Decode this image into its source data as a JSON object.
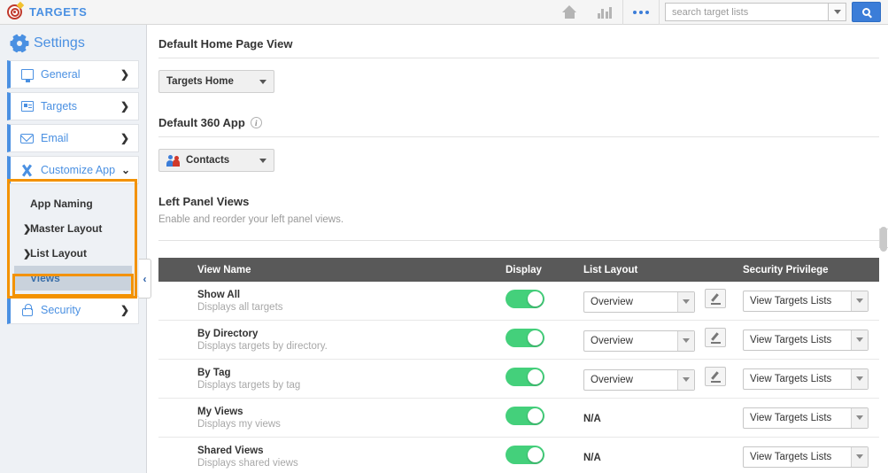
{
  "topbar": {
    "brand": "TARGETS",
    "brand_icon": "bullseye-target-icon",
    "icons": [
      {
        "name": "home-icon",
        "label": "Home"
      },
      {
        "name": "bar-chart-icon",
        "label": "Analytics"
      },
      {
        "name": "more-dots-icon",
        "label": "More"
      }
    ],
    "search": {
      "placeholder": "search target lists",
      "value": "",
      "dropdown_icon": "chevron-down-icon",
      "button_icon": "search-icon"
    }
  },
  "sidebar": {
    "title": "Settings",
    "title_icon": "gear-icon",
    "items": [
      {
        "label": "General",
        "icon": "monitor-icon",
        "chevron": "❯",
        "expanded": false
      },
      {
        "label": "Targets",
        "icon": "list-card-icon",
        "chevron": "❯",
        "expanded": false
      },
      {
        "label": "Email",
        "icon": "envelope-icon",
        "chevron": "❯",
        "expanded": false
      },
      {
        "label": "Customize App",
        "icon": "tools-icon",
        "chevron": "⌄",
        "expanded": true
      },
      {
        "label": "Security",
        "icon": "lock-icon",
        "chevron": "❯",
        "expanded": false
      }
    ],
    "sub_items": [
      {
        "label": "App Naming",
        "arrow": "",
        "selected": false
      },
      {
        "label": "Master Layout",
        "arrow": "❯",
        "selected": false
      },
      {
        "label": "List Layout",
        "arrow": "❯",
        "selected": false
      },
      {
        "label": "Views",
        "arrow": "",
        "selected": true
      }
    ],
    "collapse_handle": "‹",
    "highlight_color": "#f39200"
  },
  "main": {
    "home_page_view": {
      "title": "Default Home Page View",
      "dropdown_value": "Targets Home"
    },
    "default_360_app": {
      "title": "Default 360 App",
      "info_icon": "info-icon",
      "dropdown_value": "Contacts",
      "dropdown_icon": "people-icon"
    },
    "left_panel_views": {
      "title": "Left Panel Views",
      "description": "Enable and reorder your left panel views.",
      "columns": [
        "View Name",
        "Display",
        "List Layout",
        "Security Privilege"
      ],
      "rows": [
        {
          "name": "Show All",
          "description": "Displays all targets",
          "display_on": true,
          "list_layout": "Overview",
          "has_layout_select": true,
          "has_edit_button": true,
          "security_privilege": "View Targets Lists"
        },
        {
          "name": "By Directory",
          "description": "Displays targets by directory.",
          "display_on": true,
          "list_layout": "Overview",
          "has_layout_select": true,
          "has_edit_button": true,
          "security_privilege": "View Targets Lists"
        },
        {
          "name": "By Tag",
          "description": "Displays targets by tag",
          "display_on": true,
          "list_layout": "Overview",
          "has_layout_select": true,
          "has_edit_button": true,
          "security_privilege": "View Targets Lists"
        },
        {
          "name": "My Views",
          "description": "Displays my views",
          "display_on": true,
          "list_layout": "N/A",
          "has_layout_select": false,
          "has_edit_button": false,
          "security_privilege": "View Targets Lists"
        },
        {
          "name": "Shared Views",
          "description": "Displays shared views",
          "display_on": true,
          "list_layout": "N/A",
          "has_layout_select": false,
          "has_edit_button": false,
          "security_privilege": "View Targets Lists"
        }
      ]
    }
  },
  "colors": {
    "brand_blue": "#4a90e2",
    "accent_orange": "#f39200",
    "toggle_green": "#44d07b",
    "header_gray": "#595959"
  }
}
